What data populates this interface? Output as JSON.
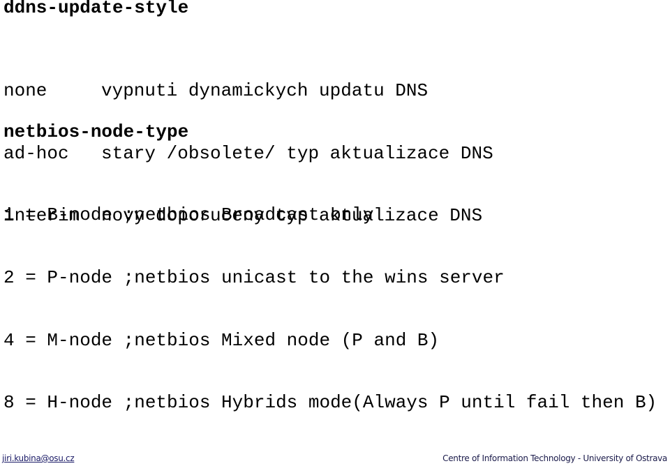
{
  "sections": {
    "ddns": {
      "heading": "ddns-update-style",
      "items": [
        {
          "term": "none",
          "description": "vypnuti dynamickych updatu DNS"
        },
        {
          "term": "ad-hoc",
          "description": "stary /obsolete/ typ aktualizace DNS"
        },
        {
          "term": "interim",
          "description": "novy doporuceny typ aktualizace DNS"
        }
      ]
    },
    "netbios": {
      "heading": "netbios-node-type",
      "items": [
        "1 = B-node ;netbios Broadcast only",
        "2 = P-node ;netbios unicast to the wins server",
        "4 = M-node ;netbios Mixed node (P and B)",
        "8 = H-node ;netbios Hybrids mode(Always P until fail then B)"
      ]
    }
  },
  "footer": {
    "email": "jiri.kubina@osu.cz",
    "organization": "Centre of Information Technology - University of Ostrava"
  }
}
